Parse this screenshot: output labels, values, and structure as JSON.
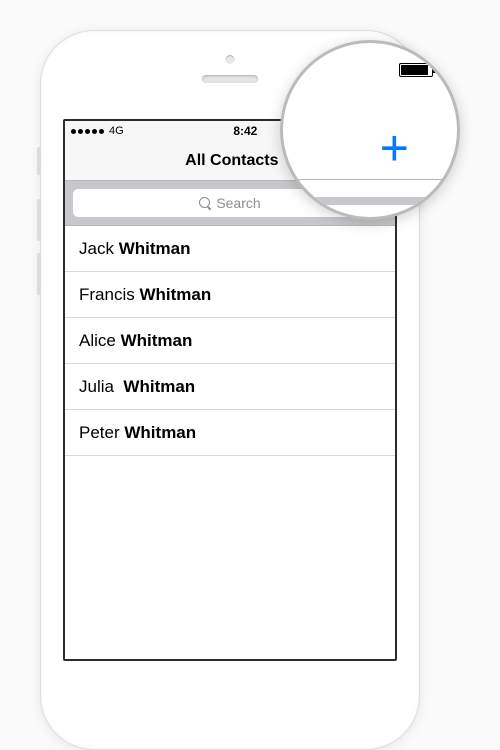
{
  "statusBar": {
    "carrier": "4G",
    "time": "8:42"
  },
  "nav": {
    "title": "All Contacts",
    "add": "+"
  },
  "search": {
    "placeholder": "Search"
  },
  "contacts": [
    {
      "first": "Jack",
      "last": "Whitman"
    },
    {
      "first": "Francis",
      "last": "Whitman"
    },
    {
      "first": "Alice",
      "last": "Whitman"
    },
    {
      "first": "Julia",
      "last": "Whitman"
    },
    {
      "first": "Peter",
      "last": "Whitman"
    }
  ],
  "magnifier": {
    "add": "+"
  }
}
